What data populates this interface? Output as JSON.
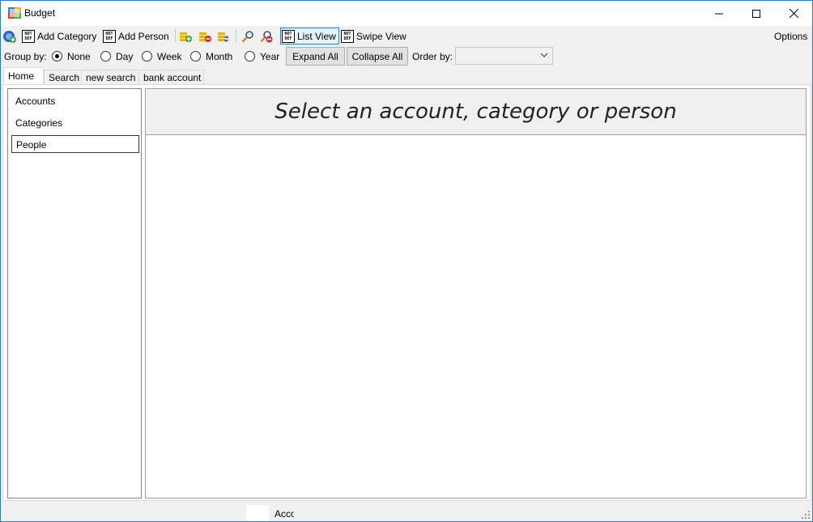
{
  "window": {
    "title": "Budget"
  },
  "toolbar": {
    "add_account_icon": "add-account-icon",
    "add_category_label": "Add Category",
    "add_person_label": "Add Person",
    "list_view_label": "List View",
    "swipe_view_label": "Swipe View",
    "options_label": "Options",
    "notdef_glyph": "NOT DEF"
  },
  "groupby": {
    "label": "Group by:",
    "options": [
      "None",
      "Day",
      "Week",
      "Month",
      "Year"
    ],
    "selected": "None",
    "expand_all": "Expand All",
    "collapse_all": "Collapse All",
    "order_by_label": "Order by:",
    "order_by_value": ""
  },
  "tabs": [
    {
      "label": "Home",
      "active": true
    },
    {
      "label": "Search",
      "active": false
    },
    {
      "label": "new search",
      "active": false
    },
    {
      "label": "bank account",
      "active": false
    }
  ],
  "sidebar": {
    "items": [
      {
        "label": "Accounts"
      },
      {
        "label": "Categories"
      },
      {
        "label": "People",
        "selected": true
      }
    ]
  },
  "main": {
    "header": "Select an account, category or person"
  },
  "status": {
    "text": "Acco"
  },
  "colors": {
    "accent": "#2b78c5",
    "selected_button_bg": "#e5f1fb"
  }
}
